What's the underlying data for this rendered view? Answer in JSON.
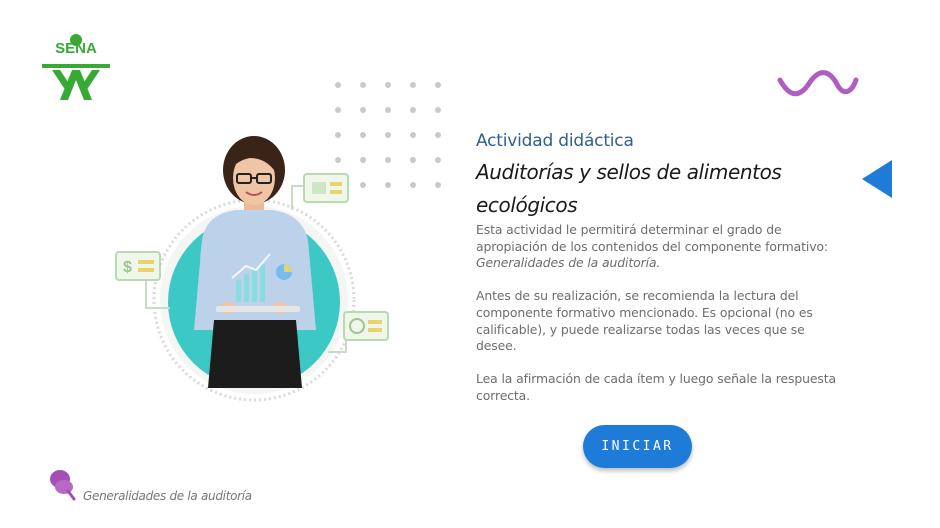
{
  "logo": {
    "text": "SENA",
    "icon": "sena-logo-icon",
    "color": "#39a935"
  },
  "content": {
    "kicker": "Actividad didáctica",
    "title": "Auditorías y sellos de alimentos ecológicos",
    "paragraph1_text": "Esta actividad le permitirá determinar el grado de apropiación de los contenidos del componente formativo: ",
    "paragraph1_emphasis": "Generalidades de la auditoría.",
    "paragraph2": "Antes de su realización, se recomienda la lectura del componente formativo mencionado.  Es opcional (no es calificable), y puede realizarse todas las veces que se desee.",
    "paragraph3": "Lea la afirmación de cada ítem y luego señale la respuesta correcta."
  },
  "start_button": {
    "label": "INICIAR",
    "color": "#1f7bd8"
  },
  "back_button": {
    "icon": "triangle-left-icon",
    "color": "#1f7bd8"
  },
  "decor": {
    "squiggle_color": "#b05dc0",
    "circle_color": "#3cc8c4"
  },
  "footer": {
    "label": "Generalidades de la auditoría",
    "icon": "pushpin-icon",
    "icon_color": "#a44fb5"
  }
}
